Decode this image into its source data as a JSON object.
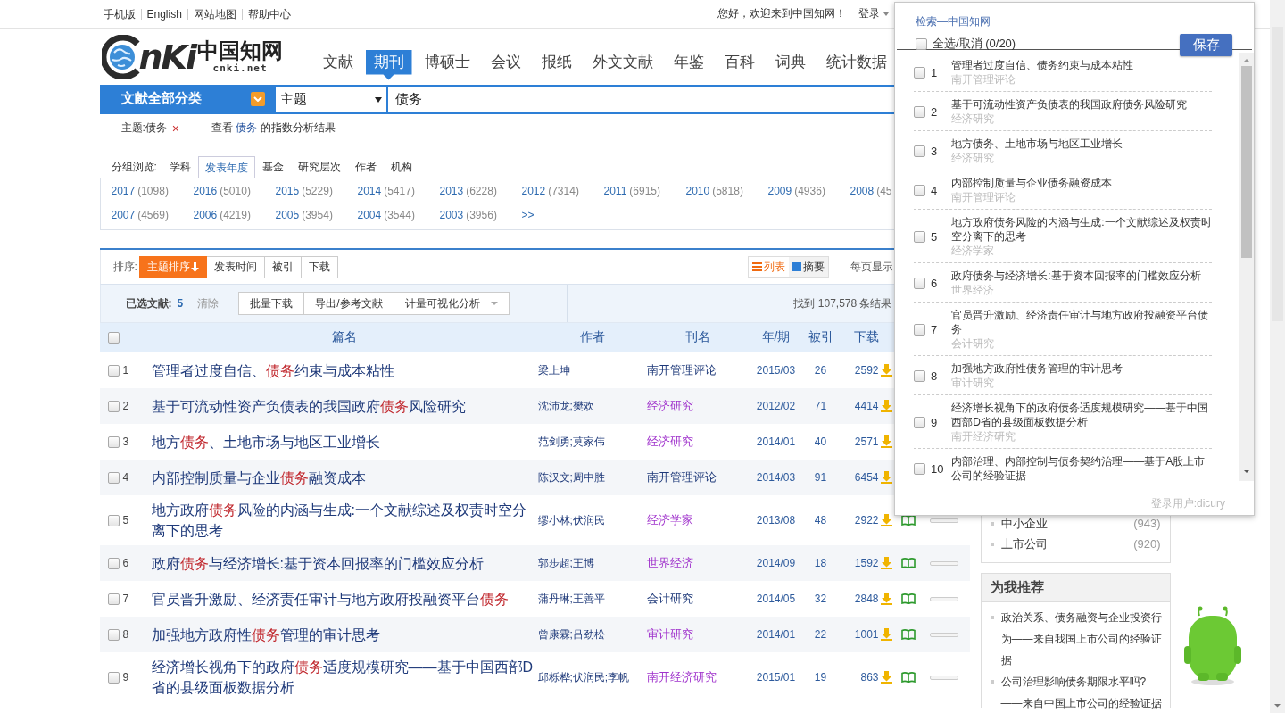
{
  "top_bar": {
    "links": [
      "手机版",
      "English",
      "网站地图",
      "帮助中心"
    ],
    "greeting": "您好，欢迎来到中国知网！",
    "login": "登录"
  },
  "logo": {
    "wordmark": "nKi",
    "chinese_name": "中国知网",
    "domain": "cnki.net"
  },
  "nav": [
    {
      "label": "文献",
      "selected": false
    },
    {
      "label": "期刊",
      "selected": true
    },
    {
      "label": "博硕士",
      "selected": false
    },
    {
      "label": "会议",
      "selected": false
    },
    {
      "label": "报纸",
      "selected": false
    },
    {
      "label": "外文文献",
      "selected": false
    },
    {
      "label": "年鉴",
      "selected": false
    },
    {
      "label": "百科",
      "selected": false
    },
    {
      "label": "词典",
      "selected": false
    },
    {
      "label": "统计数据",
      "selected": false
    }
  ],
  "search": {
    "category": "文献全部分类",
    "field": "主题",
    "value": "债务"
  },
  "filter": {
    "tag": "主题:债务",
    "remove": "×",
    "analysis": {
      "prefix": "查看 ",
      "keyword": "债务",
      "suffix": " 的指数分析结果"
    }
  },
  "group_browse": {
    "label": "分组浏览:",
    "tabs": [
      {
        "label": "学科",
        "selected": false
      },
      {
        "label": "发表年度",
        "selected": true
      },
      {
        "label": "基金",
        "selected": false
      },
      {
        "label": "研究层次",
        "selected": false
      },
      {
        "label": "作者",
        "selected": false
      },
      {
        "label": "机构",
        "selected": false
      }
    ]
  },
  "years": [
    {
      "year": "2017",
      "count": "(1098)"
    },
    {
      "year": "2016",
      "count": "(5010)"
    },
    {
      "year": "2015",
      "count": "(5229)"
    },
    {
      "year": "2014",
      "count": "(5417)"
    },
    {
      "year": "2013",
      "count": "(6228)"
    },
    {
      "year": "2012",
      "count": "(7314)"
    },
    {
      "year": "2011",
      "count": "(6915)"
    },
    {
      "year": "2010",
      "count": "(5818)"
    },
    {
      "year": "2009",
      "count": "(4936)"
    },
    {
      "year": "2008",
      "count": "(45"
    },
    {
      "year": "2007",
      "count": "(4569)"
    },
    {
      "year": "2006",
      "count": "(4219)"
    },
    {
      "year": "2005",
      "count": "(3954)"
    },
    {
      "year": "2004",
      "count": "(3544)"
    },
    {
      "year": "2003",
      "count": "(3956)"
    }
  ],
  "years_more": ">>",
  "sort": {
    "label": "排序:",
    "options": [
      {
        "label": "主题排序",
        "selected": true
      },
      {
        "label": "发表时间",
        "selected": false
      },
      {
        "label": "被引",
        "selected": false
      },
      {
        "label": "下载",
        "selected": false
      }
    ],
    "views": [
      {
        "label": "列表",
        "selected": true
      },
      {
        "label": "摘要",
        "selected": false
      }
    ],
    "per_page": "每页显示"
  },
  "selection": {
    "label": "已选文献:",
    "count": "5",
    "clear": "清除",
    "actions": [
      "批量下载",
      "导出/参考文献",
      "计量可视化分析"
    ],
    "found": "找到 107,578 条结果"
  },
  "table": {
    "select_all_checked": false,
    "columns": [
      "篇名",
      "作者",
      "刊名",
      "年/期",
      "被引",
      "下载"
    ],
    "rows": [
      {
        "no": "1",
        "checked": false,
        "title": [
          {
            "text": "管理者过度自信、",
            "highlight": false
          },
          {
            "text": "债务",
            "highlight": true
          },
          {
            "text": "约束与成本粘性",
            "highlight": false
          }
        ],
        "authors": "梁上坤",
        "journal": {
          "name": "南开管理评论",
          "color": "#1f3a7a"
        },
        "issue": "2015/03",
        "cited": "26",
        "downloads": "2592"
      },
      {
        "no": "2",
        "checked": false,
        "title": [
          {
            "text": "基于可流动性资产负债表的我国政府",
            "highlight": false
          },
          {
            "text": "债务",
            "highlight": true
          },
          {
            "text": "风险研究",
            "highlight": false
          }
        ],
        "authors": "沈沛龙;樊欢",
        "journal": {
          "name": "经济研究",
          "color": "#a033cc"
        },
        "issue": "2012/02",
        "cited": "71",
        "downloads": "4414"
      },
      {
        "no": "3",
        "checked": false,
        "title": [
          {
            "text": "地方",
            "highlight": false
          },
          {
            "text": "债务",
            "highlight": true
          },
          {
            "text": "、土地市场与地区工业增长",
            "highlight": false
          }
        ],
        "authors": "范剑勇;莫家伟",
        "journal": {
          "name": "经济研究",
          "color": "#a033cc"
        },
        "issue": "2014/01",
        "cited": "40",
        "downloads": "2571"
      },
      {
        "no": "4",
        "checked": false,
        "title": [
          {
            "text": "内部控制质量与企业",
            "highlight": false
          },
          {
            "text": "债务",
            "highlight": true
          },
          {
            "text": "融资成本",
            "highlight": false
          }
        ],
        "authors": "陈汉文;周中胜",
        "journal": {
          "name": "南开管理评论",
          "color": "#1f3a7a"
        },
        "issue": "2014/03",
        "cited": "91",
        "downloads": "6454"
      },
      {
        "no": "5",
        "checked": false,
        "title": [
          {
            "text": "地方政府",
            "highlight": false
          },
          {
            "text": "债务",
            "highlight": true
          },
          {
            "text": "风险的内涵与生成:一个文献综述及权责时空分离下的思考",
            "highlight": false
          }
        ],
        "authors": "缪小林;伏润民",
        "journal": {
          "name": "经济学家",
          "color": "#a033cc"
        },
        "issue": "2013/08",
        "cited": "48",
        "downloads": "2922"
      },
      {
        "no": "6",
        "checked": false,
        "title": [
          {
            "text": "政府",
            "highlight": false
          },
          {
            "text": "债务",
            "highlight": true
          },
          {
            "text": "与经济增长:基于资本回报率的门槛效应分析",
            "highlight": false
          }
        ],
        "authors": "郭步超;王博",
        "journal": {
          "name": "世界经济",
          "color": "#a033cc"
        },
        "issue": "2014/09",
        "cited": "18",
        "downloads": "1592"
      },
      {
        "no": "7",
        "checked": false,
        "title": [
          {
            "text": "官员晋升激励、经济责任审计与地方政府投融资平台",
            "highlight": false
          },
          {
            "text": "债务",
            "highlight": true
          }
        ],
        "authors": "蒲丹琳;王善平",
        "journal": {
          "name": "会计研究",
          "color": "#1f3a7a"
        },
        "issue": "2014/05",
        "cited": "32",
        "downloads": "2848"
      },
      {
        "no": "8",
        "checked": false,
        "title": [
          {
            "text": "加强地方政府性",
            "highlight": false
          },
          {
            "text": "债务",
            "highlight": true
          },
          {
            "text": "管理的审计思考",
            "highlight": false
          }
        ],
        "authors": "曾康霖;吕劲松",
        "journal": {
          "name": "审计研究",
          "color": "#a033cc"
        },
        "issue": "2014/01",
        "cited": "22",
        "downloads": "1001"
      },
      {
        "no": "9",
        "checked": false,
        "title": [
          {
            "text": "经济增长视角下的政府",
            "highlight": false
          },
          {
            "text": "债务",
            "highlight": true
          },
          {
            "text": "适度规模研究——基于中国西部D省的县级面板数据分析",
            "highlight": false
          }
        ],
        "authors": "邱栎桦;伏润民;李帆",
        "journal": {
          "name": "南开经济研究",
          "color": "#a033cc"
        },
        "issue": "2015/01",
        "cited": "19",
        "downloads": "863"
      }
    ]
  },
  "sidebar": {
    "keywords": [
      {
        "label": "中小企业",
        "count": "(943)"
      },
      {
        "label": "上市公司",
        "count": "(920)"
      }
    ],
    "recommend": {
      "title": "为我推荐",
      "items": [
        "政治关系、债务融资与企业投资行为——来自我国上市公司的经验证据",
        "公司治理影响债务期限水平吗?——来自中国上市公司的经验证据"
      ]
    }
  },
  "popup": {
    "title": "检索—中国知网",
    "select_all": {
      "label": "全选/取消 (0/20)",
      "checked": false
    },
    "save": "保存",
    "items": [
      {
        "no": "1",
        "checked": false,
        "title": "管理者过度自信、债务约束与成本粘性",
        "source": "南开管理评论"
      },
      {
        "no": "2",
        "checked": false,
        "title": "基于可流动性资产负债表的我国政府债务风险研究",
        "source": "经济研究"
      },
      {
        "no": "3",
        "checked": false,
        "title": "地方债务、土地市场与地区工业增长",
        "source": "经济研究"
      },
      {
        "no": "4",
        "checked": false,
        "title": "内部控制质量与企业债务融资成本",
        "source": "南开管理评论"
      },
      {
        "no": "5",
        "checked": false,
        "title": "地方政府债务风险的内涵与生成:一个文献综述及权责时空分离下的思考",
        "source": "经济学家"
      },
      {
        "no": "6",
        "checked": false,
        "title": "政府债务与经济增长:基于资本回报率的门槛效应分析",
        "source": "世界经济"
      },
      {
        "no": "7",
        "checked": false,
        "title": "官员晋升激励、经济责任审计与地方政府投融资平台债务",
        "source": "会计研究"
      },
      {
        "no": "8",
        "checked": false,
        "title": "加强地方政府性债务管理的审计思考",
        "source": "审计研究"
      },
      {
        "no": "9",
        "checked": false,
        "title": "经济增长视角下的政府债务适度规模研究——基于中国西部D省的县级面板数据分析",
        "source": "南开经济研究"
      },
      {
        "no": "10",
        "checked": false,
        "title": "内部治理、内部控制与债务契约治理——基于A股上市公司的经验证据"
      }
    ],
    "footer": "登录用户:dicury"
  }
}
